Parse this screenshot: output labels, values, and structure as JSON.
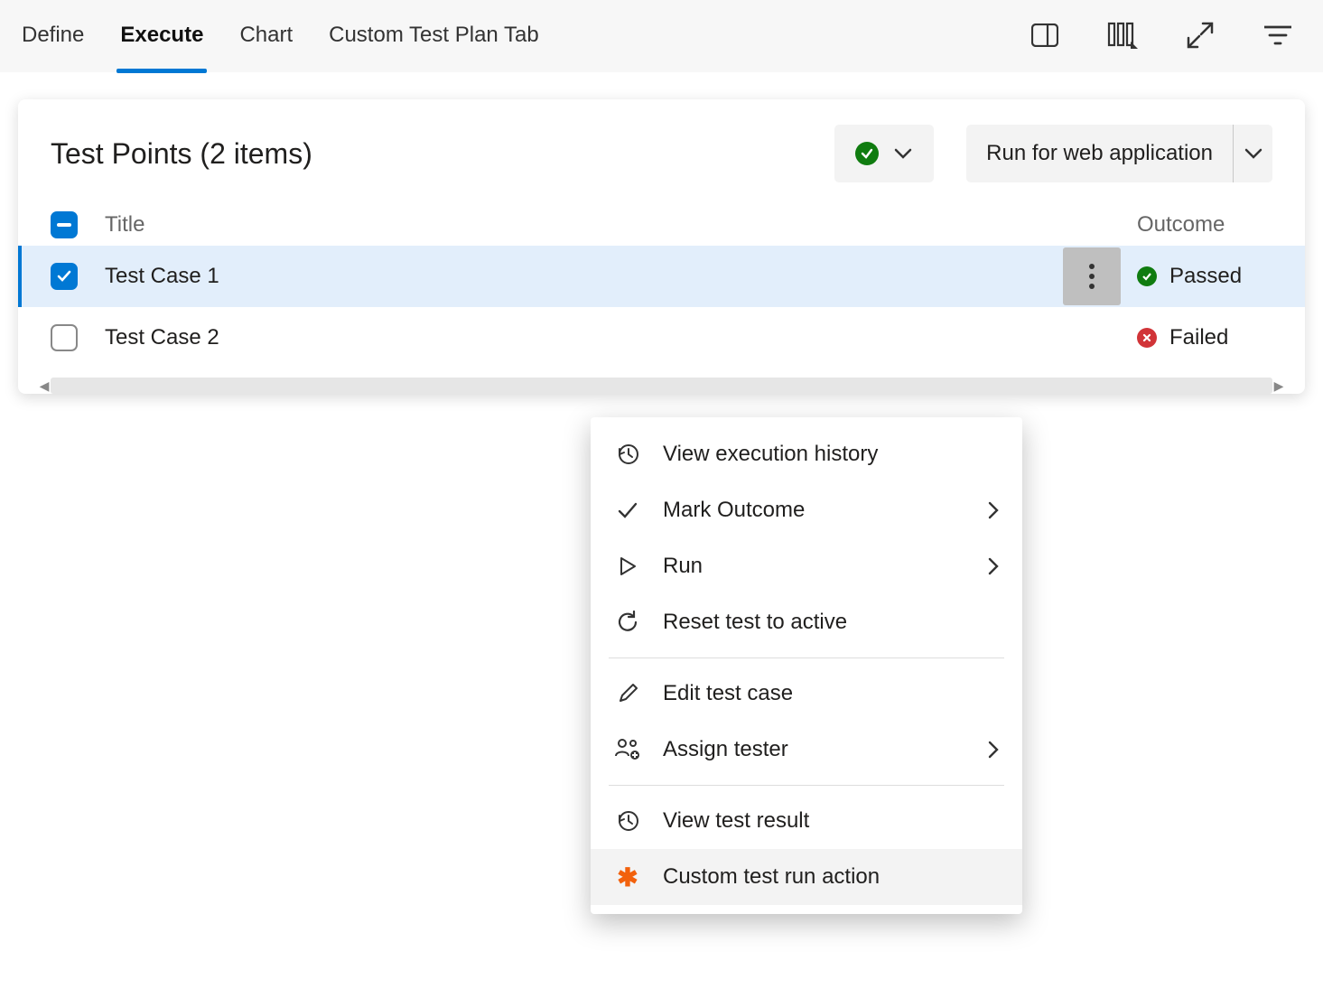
{
  "tabs": {
    "define": "Define",
    "execute": "Execute",
    "chart": "Chart",
    "custom": "Custom Test Plan Tab"
  },
  "panel": {
    "title": "Test Points (2 items)",
    "run_button": "Run for web application"
  },
  "columns": {
    "title": "Title",
    "outcome": "Outcome"
  },
  "rows": [
    {
      "title": "Test Case 1",
      "outcome": "Passed"
    },
    {
      "title": "Test Case 2",
      "outcome": "Failed"
    }
  ],
  "menu": {
    "view_history": "View execution history",
    "mark_outcome": "Mark Outcome",
    "run": "Run",
    "reset": "Reset test to active",
    "edit": "Edit test case",
    "assign": "Assign tester",
    "view_result": "View test result",
    "custom_action": "Custom test run action"
  }
}
